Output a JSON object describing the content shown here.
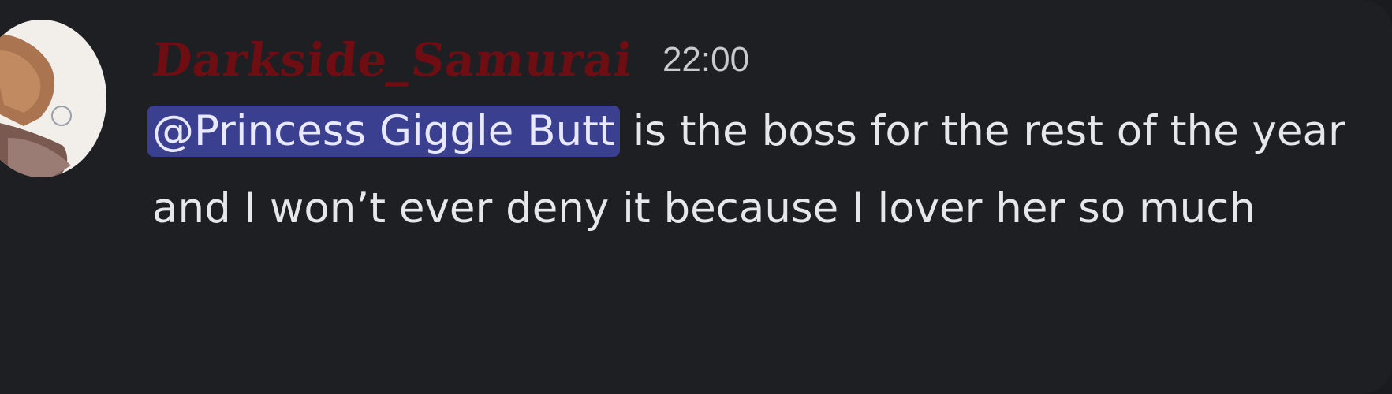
{
  "message": {
    "author": "Darkside_Samurai",
    "timestamp": "22:00",
    "mention": "@Princess Giggle Butt",
    "text": "is the boss for the rest of the year and I won’t ever deny it because I lover her so much"
  },
  "colors": {
    "background": "#1e1f23",
    "username": "#6e0d12",
    "mention_bg": "#3b3f8f",
    "text": "#e6e7ea"
  }
}
